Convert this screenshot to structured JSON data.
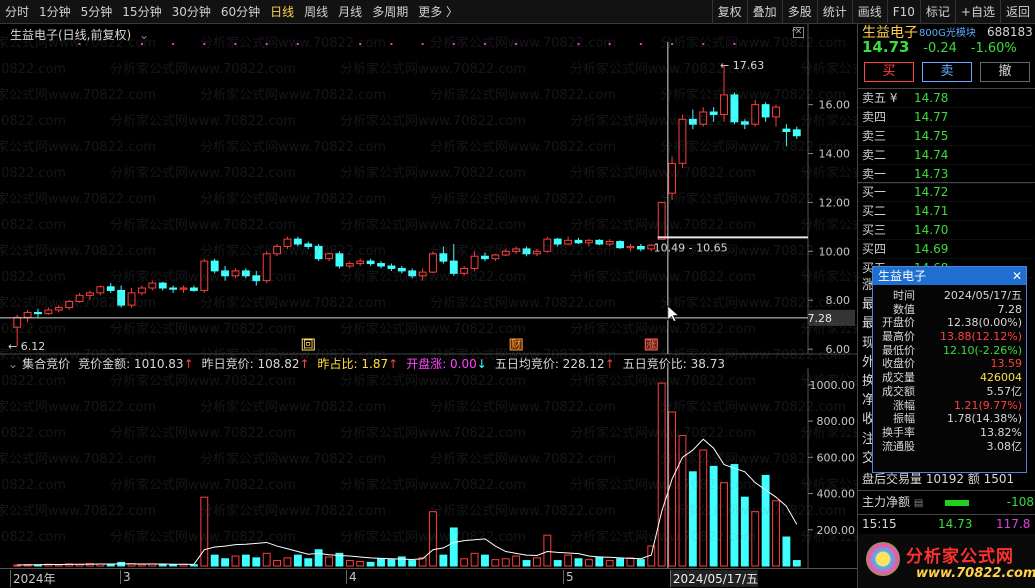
{
  "toolbar": {
    "left_items": [
      "分时",
      "1分钟",
      "5分钟",
      "15分钟",
      "30分钟",
      "60分钟",
      "日线",
      "周线",
      "月线",
      "多周期",
      "更多 〉"
    ],
    "active": "日线",
    "right_items": [
      "复权",
      "叠加",
      "多股",
      "统计",
      "画线",
      "F10",
      "标记",
      "+自选",
      "返回"
    ]
  },
  "main_chart": {
    "title": "生益电子(日线,前复权)",
    "y_axis": [
      "16.00",
      "14.00",
      "12.00",
      "10.00",
      "8.00",
      "6.00"
    ],
    "y_ticks": [
      16,
      14,
      12,
      10,
      8,
      6
    ],
    "high_label": "17.63",
    "low_label": "6.12",
    "cursor_price": "7.28",
    "range_label": "10.49 - 10.65",
    "event_tags": [
      "回",
      "财",
      "涨"
    ]
  },
  "indicator": {
    "name": "集合竞价",
    "fields": [
      {
        "label": "竞价金额:",
        "value": "1010.83",
        "arrow": "↑",
        "color": "#d8d8d8",
        "arrow_color": "#ff4040"
      },
      {
        "label": "昨日竞价:",
        "value": "108.82",
        "arrow": "↑",
        "color": "#d8d8d8",
        "arrow_color": "#ff4040"
      },
      {
        "label": "昨占比:",
        "value": "1.87",
        "arrow": "↑",
        "color": "#ffe040",
        "arrow_color": "#ff4040"
      },
      {
        "label": "开盘涨:",
        "value": "0.00",
        "arrow": "↓",
        "color": "#ff44ff",
        "arrow_color": "#40ffff"
      },
      {
        "label": "五日均竞价:",
        "value": "228.12",
        "arrow": "↑",
        "color": "#d8d8d8",
        "arrow_color": "#ff4040"
      },
      {
        "label": "五日竞价比:",
        "value": "38.73",
        "arrow": "",
        "color": "#d8d8d8",
        "arrow_color": "#ff4040"
      }
    ],
    "y_axis": [
      "1000.00",
      "800.00",
      "600.00",
      "400.00",
      "200.00"
    ],
    "y_ticks": [
      1000,
      800,
      600,
      400,
      200
    ]
  },
  "x_axis": {
    "labels": [
      "2024年",
      "3",
      "4",
      "5",
      "2024/05/17/五"
    ]
  },
  "right_panel": {
    "name": "生益电子",
    "sector": "800G光模块",
    "code": "688183",
    "price": "14.73",
    "change": "-0.24",
    "change_pct": "-1.60%",
    "buttons": {
      "buy": "买",
      "sell": "卖",
      "cancel": "撤"
    },
    "sell_levels": [
      {
        "label": "卖五 ¥",
        "price": "14.78"
      },
      {
        "label": "卖四",
        "price": "14.77"
      },
      {
        "label": "卖三",
        "price": "14.75"
      },
      {
        "label": "卖二",
        "price": "14.74"
      },
      {
        "label": "卖一",
        "price": "14.73"
      }
    ],
    "buy_levels": [
      {
        "label": "买一",
        "price": "14.72"
      },
      {
        "label": "买二",
        "price": "14.71"
      },
      {
        "label": "买三",
        "price": "14.70"
      },
      {
        "label": "买四",
        "price": "14.69"
      },
      {
        "label": "买五",
        "price": "14.68"
      }
    ],
    "partial_labels": [
      "涨",
      "最",
      "最",
      "现",
      "外",
      "换",
      "净",
      "收",
      "注",
      "交"
    ],
    "after_hours": "盘后交易量 10192 额 1501",
    "main_flow_label": "主力净额",
    "main_flow_value": "-108",
    "tick": {
      "time": "15:15",
      "price": "14.73",
      "vol": "117.8"
    }
  },
  "popup": {
    "title": "生益电子",
    "close": "✕",
    "rows": [
      {
        "k": "时间",
        "v": "2024/05/17/五",
        "c": "#d8d8d8"
      },
      {
        "k": "数值",
        "v": "7.28",
        "c": "#d8d8d8"
      },
      {
        "k": "开盘价",
        "v": "12.38(0.00%)",
        "c": "#d8d8d8"
      },
      {
        "k": "最高价",
        "v": "13.88(12.12%)",
        "c": "#ff4040"
      },
      {
        "k": "最低价",
        "v": "12.10(-2.26%)",
        "c": "#3cdc3c"
      },
      {
        "k": "收盘价",
        "v": "13.59",
        "c": "#ff4040"
      },
      {
        "k": "成交量",
        "v": "426004",
        "c": "#ffe040"
      },
      {
        "k": "成交额",
        "v": "5.57亿",
        "c": "#d8d8d8"
      },
      {
        "k": "涨幅",
        "v": "1.21(9.77%)",
        "c": "#ff4040"
      },
      {
        "k": "振幅",
        "v": "1.78(14.38%)",
        "c": "#d8d8d8"
      },
      {
        "k": "换手率",
        "v": "13.82%",
        "c": "#d8d8d8"
      },
      {
        "k": "流通股",
        "v": "3.08亿",
        "c": "#d8d8d8"
      }
    ]
  },
  "watermark": {
    "text": "分析家公式网www.70822.com",
    "logo": "分析家公式网",
    "logo_url": "www.70822.com"
  },
  "colors": {
    "up": "#ff3c3c",
    "down": "#40ffff",
    "ma": "#ffffff",
    "accent": "#ffd24a",
    "dots": "#e040e0"
  },
  "chart_data": {
    "type": "candlestick",
    "candles": [
      [
        6.9,
        7.4,
        6.12,
        7.3
      ],
      [
        7.3,
        7.6,
        7.1,
        7.5
      ],
      [
        7.5,
        7.65,
        7.3,
        7.45
      ],
      [
        7.45,
        7.7,
        7.4,
        7.6
      ],
      [
        7.6,
        7.8,
        7.5,
        7.7
      ],
      [
        7.7,
        8.0,
        7.6,
        7.95
      ],
      [
        7.95,
        8.3,
        7.9,
        8.2
      ],
      [
        8.2,
        8.4,
        8.0,
        8.3
      ],
      [
        8.3,
        8.6,
        8.2,
        8.55
      ],
      [
        8.55,
        8.7,
        8.3,
        8.4
      ],
      [
        8.4,
        8.6,
        7.7,
        7.8
      ],
      [
        7.8,
        8.5,
        7.7,
        8.3
      ],
      [
        8.3,
        8.6,
        8.2,
        8.5
      ],
      [
        8.5,
        8.8,
        8.4,
        8.7
      ],
      [
        8.7,
        8.75,
        8.4,
        8.5
      ],
      [
        8.5,
        8.6,
        8.3,
        8.45
      ],
      [
        8.45,
        8.6,
        8.3,
        8.5
      ],
      [
        8.5,
        8.6,
        8.35,
        8.4
      ],
      [
        8.4,
        9.7,
        8.3,
        9.6
      ],
      [
        9.6,
        9.7,
        9.1,
        9.2
      ],
      [
        9.2,
        9.4,
        8.8,
        9.0
      ],
      [
        9.0,
        9.3,
        8.9,
        9.2
      ],
      [
        9.2,
        9.3,
        8.9,
        9.0
      ],
      [
        9.0,
        9.2,
        8.6,
        8.8
      ],
      [
        8.8,
        10.0,
        8.7,
        9.9
      ],
      [
        9.9,
        10.3,
        9.8,
        10.2
      ],
      [
        10.2,
        10.6,
        10.1,
        10.5
      ],
      [
        10.5,
        10.6,
        10.2,
        10.3
      ],
      [
        10.3,
        10.4,
        10.1,
        10.2
      ],
      [
        10.2,
        10.3,
        9.6,
        9.7
      ],
      [
        9.7,
        9.95,
        9.6,
        9.9
      ],
      [
        9.9,
        10.0,
        9.3,
        9.4
      ],
      [
        9.4,
        9.6,
        9.3,
        9.5
      ],
      [
        9.5,
        9.7,
        9.4,
        9.6
      ],
      [
        9.6,
        9.7,
        9.4,
        9.5
      ],
      [
        9.5,
        9.6,
        9.3,
        9.4
      ],
      [
        9.4,
        9.5,
        9.2,
        9.3
      ],
      [
        9.3,
        9.4,
        9.1,
        9.2
      ],
      [
        9.2,
        9.3,
        8.9,
        9.0
      ],
      [
        9.0,
        9.3,
        8.8,
        9.15
      ],
      [
        9.15,
        10.0,
        9.1,
        9.9
      ],
      [
        9.9,
        10.2,
        9.5,
        9.6
      ],
      [
        9.6,
        10.3,
        9.0,
        9.1
      ],
      [
        9.1,
        9.4,
        9.0,
        9.3
      ],
      [
        9.3,
        10.0,
        9.2,
        9.8
      ],
      [
        9.8,
        9.95,
        9.6,
        9.7
      ],
      [
        9.7,
        9.9,
        9.6,
        9.85
      ],
      [
        9.85,
        10.1,
        9.8,
        10.0
      ],
      [
        10.0,
        10.2,
        9.9,
        10.1
      ],
      [
        10.1,
        10.2,
        9.8,
        9.9
      ],
      [
        9.9,
        10.1,
        9.8,
        10.0
      ],
      [
        10.0,
        10.6,
        9.95,
        10.5
      ],
      [
        10.5,
        10.55,
        10.2,
        10.3
      ],
      [
        10.3,
        10.6,
        10.25,
        10.45
      ],
      [
        10.45,
        10.55,
        10.3,
        10.35
      ],
      [
        10.35,
        10.5,
        10.2,
        10.45
      ],
      [
        10.45,
        10.5,
        10.25,
        10.3
      ],
      [
        10.3,
        10.5,
        10.2,
        10.4
      ],
      [
        10.4,
        10.45,
        10.1,
        10.15
      ],
      [
        10.15,
        10.3,
        10.0,
        10.2
      ],
      [
        10.2,
        10.3,
        10.0,
        10.1
      ],
      [
        10.1,
        10.3,
        10.0,
        10.25
      ],
      [
        10.49,
        12.0,
        10.49,
        12.0
      ],
      [
        12.38,
        13.88,
        12.1,
        13.59
      ],
      [
        13.6,
        15.6,
        13.4,
        15.4
      ],
      [
        15.4,
        15.8,
        15.0,
        15.2
      ],
      [
        15.2,
        15.9,
        15.1,
        15.7
      ],
      [
        15.7,
        15.9,
        15.3,
        15.6
      ],
      [
        15.6,
        17.63,
        15.3,
        16.4
      ],
      [
        16.4,
        16.5,
        15.2,
        15.3
      ],
      [
        15.3,
        15.4,
        15.0,
        15.2
      ],
      [
        15.2,
        16.2,
        15.1,
        16.0
      ],
      [
        16.0,
        16.1,
        15.3,
        15.5
      ],
      [
        15.5,
        16.0,
        15.1,
        15.9
      ],
      [
        15.0,
        15.2,
        14.3,
        14.9
      ],
      [
        14.97,
        15.1,
        14.6,
        14.73
      ]
    ],
    "ylim": [
      5.8,
      18.4
    ],
    "volume": [
      5,
      8,
      6,
      10,
      7,
      12,
      9,
      14,
      11,
      10,
      20,
      13,
      9,
      12,
      10,
      8,
      9,
      7,
      380,
      60,
      40,
      55,
      60,
      45,
      70,
      30,
      45,
      60,
      40,
      90,
      50,
      70,
      30,
      25,
      20,
      40,
      35,
      50,
      30,
      45,
      300,
      60,
      210,
      40,
      70,
      60,
      35,
      40,
      55,
      30,
      45,
      170,
      30,
      60,
      40,
      35,
      50,
      30,
      40,
      45,
      35,
      110,
      1010,
      850,
      720,
      520,
      640,
      550,
      460,
      560,
      380,
      300,
      500,
      360,
      160,
      30
    ],
    "vol_ma": [
      6,
      6,
      7,
      8,
      8,
      9,
      10,
      10,
      11,
      11,
      12,
      12,
      11,
      11,
      11,
      10,
      10,
      9,
      90,
      105,
      110,
      118,
      120,
      125,
      130,
      110,
      95,
      80,
      65,
      70,
      62,
      58,
      55,
      50,
      45,
      42,
      40,
      38,
      36,
      40,
      90,
      100,
      130,
      140,
      145,
      150,
      110,
      80,
      70,
      60,
      58,
      80,
      75,
      72,
      68,
      55,
      50,
      48,
      45,
      42,
      40,
      60,
      300,
      480,
      600,
      640,
      700,
      650,
      560,
      540,
      520,
      460,
      420,
      380,
      330,
      230
    ],
    "vol_ylim": [
      0,
      1060
    ]
  }
}
